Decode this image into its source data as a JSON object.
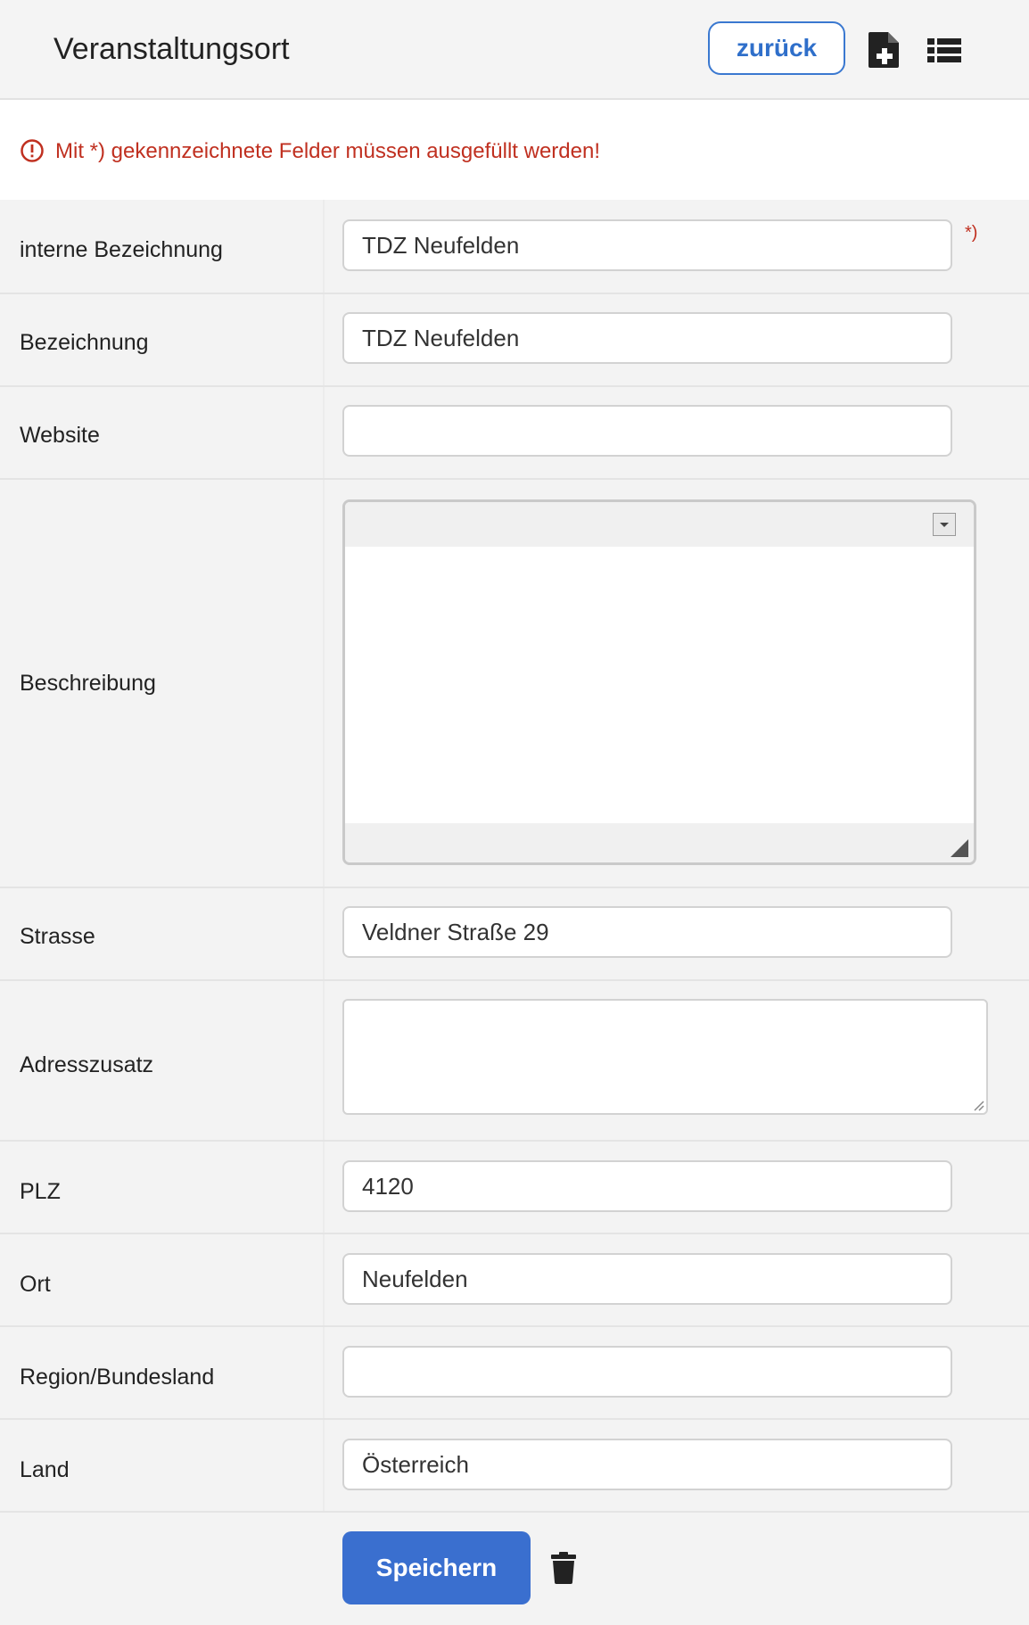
{
  "header": {
    "title": "Veranstaltungsort",
    "back_label": "zurück",
    "new_icon": "file-plus-icon",
    "list_icon": "list-icon"
  },
  "notice": {
    "text": "Mit *) gekennzeichnete Felder müssen ausgefüllt werden!",
    "icon": "alert-circle-icon",
    "color": "#c03020"
  },
  "form": {
    "interne_bezeichnung": {
      "label": "interne Bezeichnung",
      "value": "TDZ Neufelden",
      "required_mark": "*)"
    },
    "bezeichnung": {
      "label": "Bezeichnung",
      "value": "TDZ Neufelden"
    },
    "website": {
      "label": "Website",
      "value": ""
    },
    "beschreibung": {
      "label": "Beschreibung",
      "value": ""
    },
    "strasse": {
      "label": "Strasse",
      "value": "Veldner Straße 29"
    },
    "adresszusatz": {
      "label": "Adresszusatz",
      "value": ""
    },
    "plz": {
      "label": "PLZ",
      "value": "4120"
    },
    "ort": {
      "label": "Ort",
      "value": "Neufelden"
    },
    "region": {
      "label": "Region/Bundesland",
      "value": ""
    },
    "land": {
      "label": "Land",
      "value": "Österreich"
    }
  },
  "actions": {
    "save_label": "Speichern",
    "delete_icon": "trash-icon",
    "accent_color": "#3a6fcf"
  }
}
